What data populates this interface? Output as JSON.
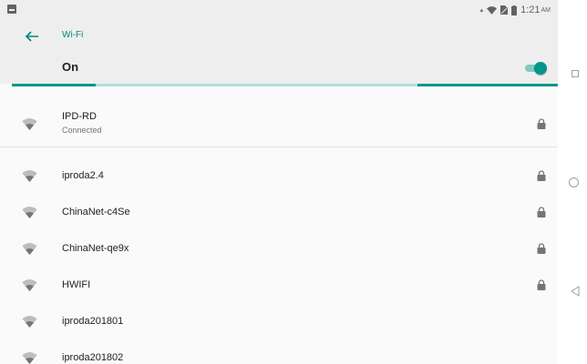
{
  "status_bar": {
    "left_icon": "image-icon",
    "time": "1:21",
    "ampm": "AM",
    "icons": [
      "signal-indicator-icon",
      "wifi-icon",
      "no-sim-icon",
      "battery-icon"
    ]
  },
  "app_bar": {
    "back_icon": "back-arrow-icon",
    "title": "Wi-Fi"
  },
  "master_switch": {
    "label": "On",
    "state": "on"
  },
  "networks": [
    {
      "name": "IPD-RD",
      "status": "Connected",
      "secured": true
    },
    {
      "name": "iproda2.4",
      "secured": true
    },
    {
      "name": "ChinaNet-c4Se",
      "secured": true
    },
    {
      "name": "ChinaNet-qe9x",
      "secured": true
    },
    {
      "name": "HWIFI",
      "secured": true
    },
    {
      "name": "iproda201801",
      "secured": false
    },
    {
      "name": "iproda201802",
      "secured": false
    }
  ],
  "nav_bar": {
    "icons": [
      "recents-icon",
      "home-icon",
      "back-icon"
    ]
  },
  "colors": {
    "accent": "#009688",
    "title_teal": "#00897b",
    "header_bg": "#eeeeee",
    "background": "#fafafa"
  }
}
